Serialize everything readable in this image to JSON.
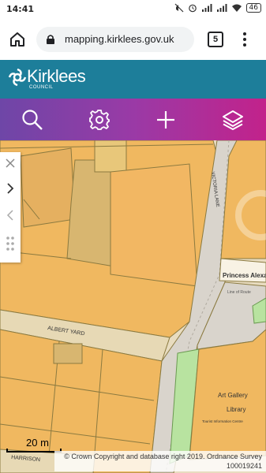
{
  "status_bar": {
    "time": "14:41",
    "battery": "46",
    "icons": [
      "mute-icon",
      "alarm-icon",
      "signal-icon",
      "signal-icon",
      "wifi-icon",
      "battery-icon"
    ]
  },
  "browser": {
    "url": "mapping.kirklees.gov.uk",
    "tab_count": "5",
    "icons": [
      "home-icon",
      "lock-icon",
      "tabs-icon",
      "more-vert-icon"
    ]
  },
  "header": {
    "logo_name": "Kirklees",
    "logo_subtitle": "COUNCIL",
    "background": "#1d7e9a"
  },
  "toolbar": {
    "tools": [
      {
        "name": "search",
        "icon": "search-icon"
      },
      {
        "name": "settings",
        "icon": "gear-icon"
      },
      {
        "name": "add",
        "icon": "plus-icon"
      },
      {
        "name": "layers",
        "icon": "layers-icon"
      }
    ],
    "gradient": [
      "#6e46a7",
      "#c2228b"
    ]
  },
  "map": {
    "labels": {
      "albert_yard": "ALBERT YARD",
      "victoria_lane": "VICTORIA LANE",
      "princess_alexandra": "Princess Alexan",
      "line_of_route": "Line of Route",
      "art_gallery": "Art Gallery",
      "library": "Library",
      "tourist_info": "Tourist Information Centre",
      "harrison": "HARRISON"
    },
    "colors": {
      "building": "#f0b860",
      "road": "#e7d9b5",
      "pedestrian": "#d9d4cc",
      "grass": "#b8e3a0",
      "outline": "#8b7a40"
    },
    "side_panel": [
      "close-icon",
      "chevron-right-icon",
      "chevron-left-icon",
      "drag-handle-icon"
    ],
    "scale": "20 m",
    "copyright_line1": "© Crown Copyright and database right 2019. Ordnance Survey",
    "copyright_line2": "100019241"
  }
}
